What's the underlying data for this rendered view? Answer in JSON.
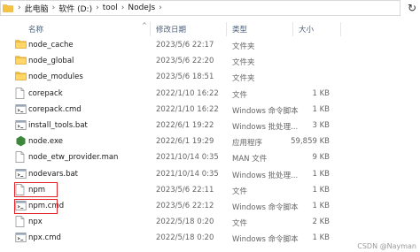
{
  "breadcrumb": {
    "items": [
      "此电脑",
      "软件 (D:)",
      "tool",
      "NodeJs"
    ],
    "separator": "›"
  },
  "columns": {
    "name": "名称",
    "date": "修改日期",
    "type": "类型",
    "size": "大小"
  },
  "files": [
    {
      "name": "node_cache",
      "date": "2023/5/6 22:17",
      "type": "文件夹",
      "size": "",
      "icon": "folder-icon"
    },
    {
      "name": "node_global",
      "date": "2023/5/6 22:20",
      "type": "文件夹",
      "size": "",
      "icon": "folder-icon"
    },
    {
      "name": "node_modules",
      "date": "2023/5/6 18:51",
      "type": "文件夹",
      "size": "",
      "icon": "folder-icon"
    },
    {
      "name": "corepack",
      "date": "2022/1/10 16:22",
      "type": "文件",
      "size": "1 KB",
      "icon": "file-icon"
    },
    {
      "name": "corepack.cmd",
      "date": "2022/1/10 16:22",
      "type": "Windows 命令脚本",
      "size": "1 KB",
      "icon": "cmd-icon"
    },
    {
      "name": "install_tools.bat",
      "date": "2022/6/1 19:22",
      "type": "Windows 批处理...",
      "size": "3 KB",
      "icon": "cmd-icon"
    },
    {
      "name": "node.exe",
      "date": "2022/6/1 19:29",
      "type": "应用程序",
      "size": "59,859 KB",
      "icon": "node-exe-icon"
    },
    {
      "name": "node_etw_provider.man",
      "date": "2021/10/14 0:35",
      "type": "MAN 文件",
      "size": "9 KB",
      "icon": "file-icon"
    },
    {
      "name": "nodevars.bat",
      "date": "2021/10/14 0:35",
      "type": "Windows 批处理...",
      "size": "1 KB",
      "icon": "cmd-icon"
    },
    {
      "name": "npm",
      "date": "2023/5/6 22:11",
      "type": "文件",
      "size": "1 KB",
      "icon": "file-icon"
    },
    {
      "name": "npm.cmd",
      "date": "2023/5/6 22:12",
      "type": "Windows 命令脚本",
      "size": "1 KB",
      "icon": "cmd-icon"
    },
    {
      "name": "npx",
      "date": "2022/5/18 0:20",
      "type": "文件",
      "size": "2 KB",
      "icon": "file-icon"
    },
    {
      "name": "npx.cmd",
      "date": "2022/5/18 0:20",
      "type": "Windows 命令脚本",
      "size": "1 KB",
      "icon": "cmd-icon"
    }
  ],
  "highlighted_files": [
    "npm",
    "npm.cmd"
  ],
  "watermark": "CSDN @Nayman",
  "colors": {
    "folder": "#f5c242",
    "highlight": "#e0262b",
    "node_green": "#3c873a",
    "header_text": "#4c607a"
  }
}
